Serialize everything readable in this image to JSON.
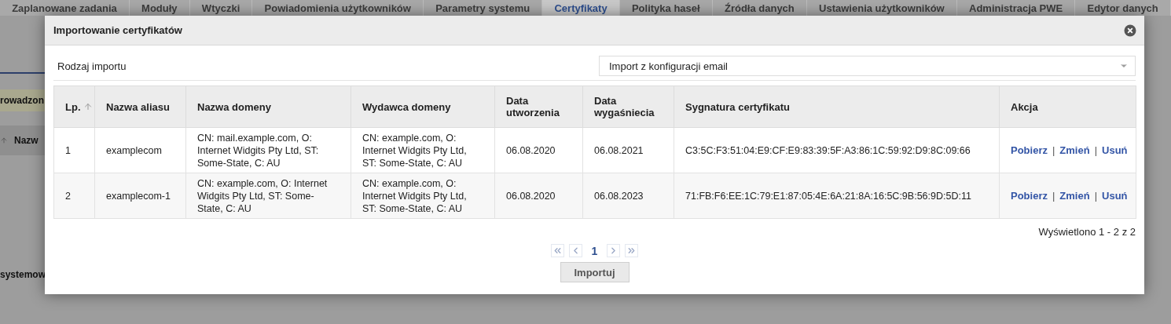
{
  "tabs": [
    {
      "label": "Zaplanowane zadania",
      "selected": false
    },
    {
      "label": "Moduły",
      "selected": false
    },
    {
      "label": "Wtyczki",
      "selected": false
    },
    {
      "label": "Powiadomienia użytkowników",
      "selected": false
    },
    {
      "label": "Parametry systemu",
      "selected": false
    },
    {
      "label": "Certyfikaty",
      "selected": true
    },
    {
      "label": "Polityka haseł",
      "selected": false
    },
    {
      "label": "Źródła danych",
      "selected": false
    },
    {
      "label": "Ustawienia użytkowników",
      "selected": false
    },
    {
      "label": "Administracja PWE",
      "selected": false
    },
    {
      "label": "Edytor danych",
      "selected": false
    }
  ],
  "background": {
    "banner_fragment": "rowadzon",
    "column_fragment": "Nazw",
    "section_fragment": "systemow"
  },
  "dialog": {
    "title": "Importowanie certyfikatów",
    "import_type": {
      "label": "Rodzaj importu",
      "value": "Import z konfiguracji email"
    },
    "table": {
      "columns": [
        {
          "label": "Lp.",
          "sorted": true
        },
        {
          "label": "Nazwa aliasu",
          "sorted": false
        },
        {
          "label": "Nazwa domeny",
          "sorted": false
        },
        {
          "label": "Wydawca domeny",
          "sorted": false
        },
        {
          "label": "Data utworzenia",
          "sorted": false
        },
        {
          "label": "Data wygaśniecia",
          "sorted": false
        },
        {
          "label": "Sygnatura certyfikatu",
          "sorted": false
        },
        {
          "label": "Akcja",
          "sorted": false
        }
      ],
      "rows": [
        {
          "cells": [
            "1",
            "examplecom",
            "CN: mail.example.com, O: Internet Widgits Pty Ltd, ST: Some-State, C: AU",
            "CN: example.com, O: Internet Widgits Pty Ltd, ST: Some-State, C: AU",
            "06.08.2020",
            "06.08.2021",
            "C3:5C:F3:51:04:E9:CF:E9:83:39:5F:A3:86:1C:59:92:D9:8C:09:66"
          ],
          "actions": [
            "Pobierz",
            "Zmień",
            "Usuń"
          ]
        },
        {
          "cells": [
            "2",
            "examplecom-1",
            "CN: example.com, O: Internet Widgits Pty Ltd, ST: Some-State, C: AU",
            "CN: example.com, O: Internet Widgits Pty Ltd, ST: Some-State, C: AU",
            "06.08.2020",
            "06.08.2023",
            "71:FB:F6:EE:1C:79:E1:87:05:4E:6A:21:8A:16:5C:9B:56:9D:5D:11"
          ],
          "actions": [
            "Pobierz",
            "Zmień",
            "Usuń"
          ]
        }
      ],
      "action_separator": "|"
    },
    "summary": "Wyświetlono 1 - 2 z 2",
    "pager": {
      "page": "1"
    },
    "submit": "Importuj"
  }
}
